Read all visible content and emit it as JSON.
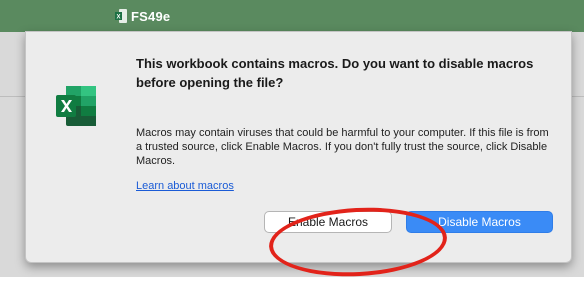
{
  "window": {
    "title": "FS49e",
    "title_icon": "excel-file-icon"
  },
  "dialog": {
    "app_icon": "excel-app-icon",
    "heading": "This workbook contains macros. Do you want to disable macros before opening the file?",
    "body": "Macros may contain viruses that could be harmful to your computer.  If this file is from a trusted source, click Enable Macros. If you don't fully trust the source, click Disable Macros.",
    "learn_link": "Learn about macros",
    "buttons": {
      "enable": "Enable Macros",
      "disable": "Disable Macros"
    }
  },
  "colors": {
    "titlebar": "#5a8a5f",
    "primary_button": "#3a8bf6",
    "link": "#1a5bd6",
    "annotation": "#e2231a"
  }
}
